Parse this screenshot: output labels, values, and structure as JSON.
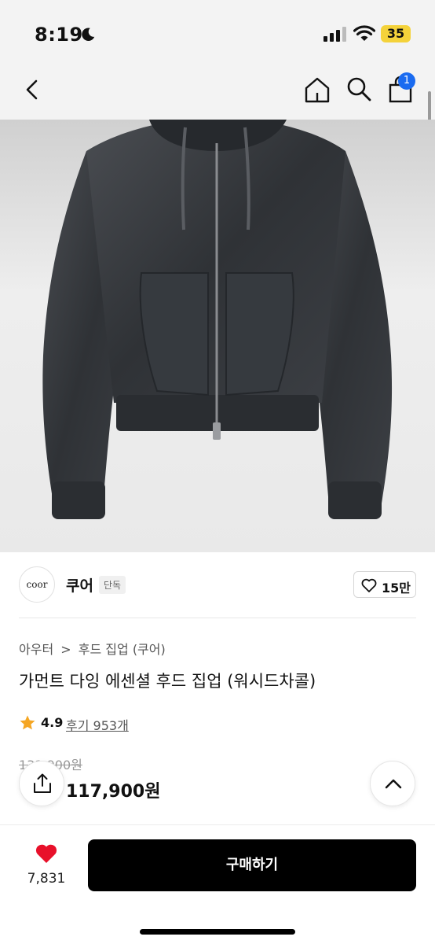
{
  "status_bar": {
    "time": "8:19",
    "battery": "35"
  },
  "header": {
    "cart_count": "1"
  },
  "brand": {
    "logo_text": "coor",
    "name": "쿠어",
    "tag": "단독",
    "like_count": "15만"
  },
  "breadcrumb": [
    "아우터",
    ">",
    "후드 집업 (쿠어)"
  ],
  "product": {
    "title": "가먼트 다잉 에센셜 후드 집업 (워시드차콜)",
    "rating": "4.9",
    "review_text": "후기 953개",
    "original_price": "131,900원",
    "sale_price": "117,900원"
  },
  "bottom_bar": {
    "wish_count": "7,831",
    "buy_label": "구매하기"
  },
  "colors": {
    "accent_badge": "#1a6bf0",
    "heart": "#e8102a",
    "star": "#f5a623",
    "buy_button": "#000000",
    "battery": "#f4d23a"
  },
  "icons": [
    "back-icon",
    "home-icon",
    "search-icon",
    "shopping-bag-icon",
    "heart-outline-icon",
    "star-icon",
    "share-icon",
    "chevron-up-icon",
    "heart-filled-icon"
  ]
}
